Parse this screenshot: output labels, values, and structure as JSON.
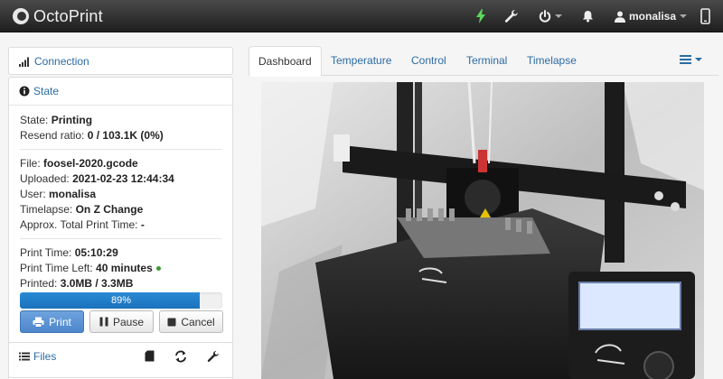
{
  "navbar": {
    "brand": "OctoPrint",
    "user": "monalisa",
    "icons": [
      "power-bolt-icon",
      "wrench-icon",
      "power-icon",
      "bell-icon",
      "user-icon",
      "phone-icon"
    ]
  },
  "connection": {
    "title": "Connection"
  },
  "state": {
    "title": "State",
    "state_label": "State:",
    "state_value": "Printing",
    "resend_label": "Resend ratio:",
    "resend_value": "0 / 103.1K (0%)",
    "file_label": "File:",
    "file_value": "foosel-2020.gcode",
    "uploaded_label": "Uploaded:",
    "uploaded_value": "2021-02-23 12:44:34",
    "user_label": "User:",
    "user_value": "monalisa",
    "timelapse_label": "Timelapse:",
    "timelapse_value": "On Z Change",
    "approx_label": "Approx. Total Print Time:",
    "approx_value": "-",
    "print_time_label": "Print Time:",
    "print_time_value": "05:10:29",
    "time_left_label": "Print Time Left:",
    "time_left_value": "40 minutes",
    "printed_label": "Printed:",
    "printed_value": "3.0MB / 3.3MB",
    "progress": 0.89,
    "progress_text": "89%"
  },
  "buttons": {
    "print": "Print",
    "pause": "Pause",
    "cancel": "Cancel"
  },
  "files": {
    "title": "Files"
  },
  "tabs": [
    "Dashboard",
    "Temperature",
    "Control",
    "Terminal",
    "Timelapse"
  ],
  "colors": {
    "accent": "#2b6ca3",
    "progress": "#1a72ba",
    "primary_button": "#4d86cc",
    "navbar": "#2a2a2a"
  }
}
